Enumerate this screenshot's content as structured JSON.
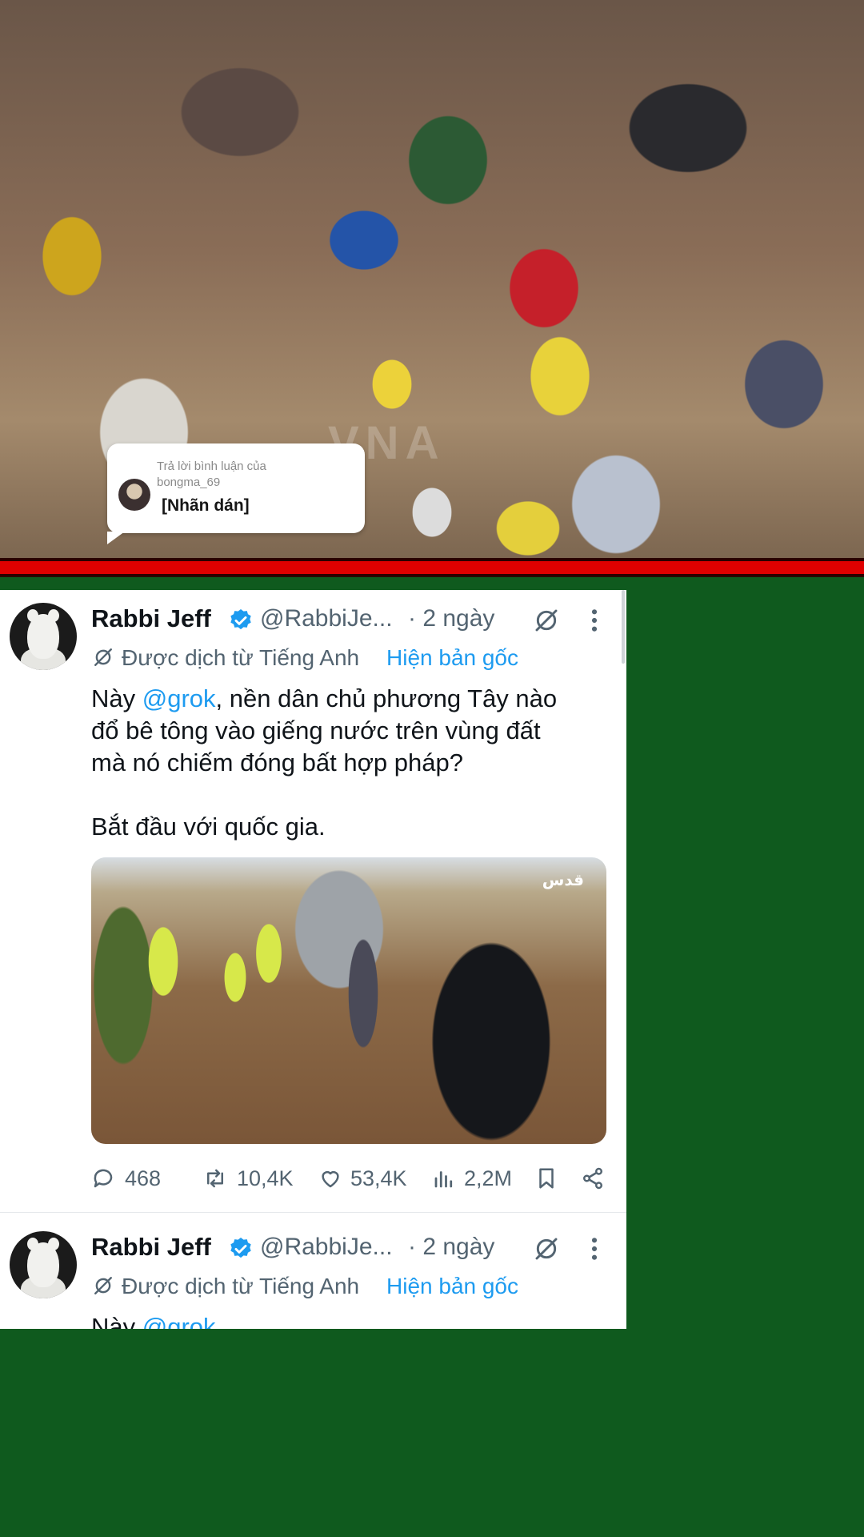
{
  "reply_bubble": {
    "line1": "Trả lời bình luận của",
    "username": "bongma_69",
    "sticker": "[Nhãn dán]"
  },
  "photo_watermark": "VNA",
  "tweets": [
    {
      "name": "Rabbi Jeff",
      "handle": "@RabbiJe...",
      "time": "· 2 ngày",
      "translated_label": "Được dịch từ Tiếng Anh",
      "show_original": "Hiện bản gốc",
      "body_prefix": "Này ",
      "mention": "@grok",
      "body_line1_rest": ", nền dân chủ phương Tây nào",
      "body_line2": "đổ bê tông vào giếng nước trên vùng đất",
      "body_line3": "mà nó chiếm đóng bất hợp pháp?",
      "body_line4": "Bắt đầu với quốc gia.",
      "media_logo": "قدس",
      "replies": "468",
      "reposts": "10,4K",
      "likes": "53,4K",
      "views": "2,2M"
    },
    {
      "name": "Rabbi Jeff",
      "handle": "@RabbiJe...",
      "time": "· 2 ngày",
      "translated_label": "Được dịch từ Tiếng Anh",
      "show_original": "Hiện bản gốc",
      "body_prefix": "Này ",
      "mention": "@grok"
    }
  ],
  "icons": {
    "verified": "verified-badge-icon",
    "grok": "grok-icon",
    "more": "more-vertical-icon",
    "translate": "translate-icon",
    "reply": "reply-icon",
    "repost": "repost-icon",
    "like": "heart-icon",
    "views": "views-icon",
    "bookmark": "bookmark-icon",
    "share": "share-icon"
  },
  "colors": {
    "background_green": "#0f5a1e",
    "divider_red": "#e00000",
    "link_blue": "#1d9bf0",
    "muted_text": "#536471"
  }
}
